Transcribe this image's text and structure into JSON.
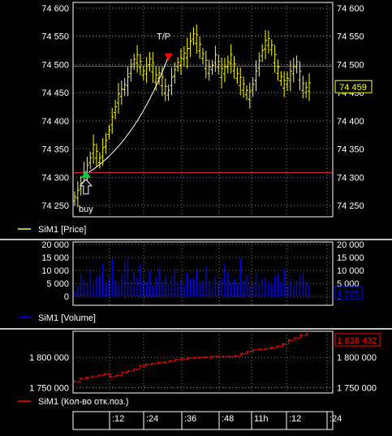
{
  "chart_data": [
    {
      "type": "line",
      "series": [
        {
          "name": "SiM1 [Price]",
          "style": "ohlc-bars",
          "color": "#ffff00",
          "values": [
            74262,
            74270,
            74285,
            74300,
            74315,
            74330,
            74350,
            74340,
            74330,
            74345,
            74360,
            74380,
            74400,
            74420,
            74440,
            74450,
            74460,
            74470,
            74490,
            74505,
            74510,
            74500,
            74485,
            74490,
            74505,
            74495,
            74475,
            74480,
            74470,
            74455,
            74450,
            74470,
            74485,
            74500,
            74505,
            74515,
            74520,
            74535,
            74550,
            74545,
            74530,
            74515,
            74500,
            74490,
            74495,
            74510,
            74500,
            74485,
            74490,
            74500,
            74510,
            74495,
            74480,
            74470,
            74460,
            74450,
            74445,
            74460,
            74480,
            74500,
            74520,
            74535,
            74540,
            74530,
            74510,
            74490,
            74475,
            74465,
            74470,
            74480,
            74490,
            74500,
            74480,
            74460,
            74455,
            74460
          ]
        }
      ],
      "ylim": [
        74230,
        74610
      ],
      "yticks": [
        "74 600",
        "74 550",
        "74 500",
        "74 450",
        "74 400",
        "74 350",
        "74 300",
        "74 250"
      ],
      "hlines": [
        {
          "value": 74497,
          "color": "#ff3030"
        },
        {
          "value": 74308,
          "color": "#ff3030"
        }
      ],
      "annotations": [
        {
          "text": "T/P",
          "x_index": 30,
          "y": 74514
        },
        {
          "text": "buy",
          "x_index": 1,
          "y": 74305
        }
      ],
      "last_value_label": "74 459",
      "legend": "SiM1 [Price]"
    },
    {
      "type": "bar",
      "series": [
        {
          "name": "SiM1 [Volume]",
          "color": "#0000ff",
          "values": [
            2000,
            4200,
            8600,
            6500,
            5200,
            10500,
            4200,
            7600,
            8100,
            12400,
            4800,
            6800,
            14200,
            6100,
            4400,
            8400,
            13200,
            15100,
            5600,
            9100,
            7400,
            12300,
            6400,
            5300,
            9800,
            4200,
            7200,
            11000,
            5600,
            8000,
            4600,
            7900,
            10800,
            5100,
            6300,
            4000,
            9200,
            6600,
            7100,
            9900,
            4900,
            6000,
            11700,
            6200,
            4300,
            7900,
            5000,
            7000,
            12600,
            9300,
            5100,
            6800,
            4800,
            14800,
            6200,
            8300,
            3900,
            5600,
            8900,
            4500,
            6900,
            7300,
            5600,
            4500,
            7600,
            8400,
            5700,
            10300,
            4100,
            6800,
            4300,
            5900,
            8100,
            9000,
            5800,
            4400
          ]
        }
      ],
      "ylim": [
        0,
        20000
      ],
      "yticks": [
        "20 000",
        "15 000",
        "10 000",
        "5 000",
        "0"
      ],
      "last_value_label": "1 926",
      "legend": "SiM1 [Volume]"
    },
    {
      "type": "line",
      "series": [
        {
          "name": "SiM1 (Кол-во отк.поз.)",
          "style": "steps",
          "color": "#ff0000",
          "values": [
            1760000,
            1765000,
            1766500,
            1768000,
            1770000,
            1772000,
            1768000,
            1770000,
            1775000,
            1777000,
            1780000,
            1786000,
            1788000,
            1789500,
            1791000,
            1792000,
            1794000,
            1796000,
            1797000,
            1798500,
            1799000,
            1800000,
            1800000,
            1801000,
            1801000,
            1801000,
            1801000,
            1802000,
            1806000,
            1809000,
            1812000,
            1813000,
            1814000,
            1816000,
            1818000,
            1822000,
            1828000,
            1832000,
            1836000,
            1838432
          ]
        }
      ],
      "ylim": [
        1741000,
        1843000
      ],
      "yticks": [
        "1 800 000",
        "1 750 000"
      ],
      "last_value_label": "1 838 432",
      "legend": "SiM1 (Кол-во отк.поз.)"
    }
  ],
  "x_axis": {
    "ticks": [
      ":12",
      ":24",
      ":36",
      ":48",
      "11h",
      ":12",
      ":24"
    ]
  },
  "colors": {
    "background": "#000000",
    "frame": "#ffffff",
    "grid": "#cfcfcf",
    "price": "#ffff00",
    "volume": "#0000ff",
    "positions": "#ff0000",
    "hline": "#ff3030",
    "annotation_curve": "#ffffff",
    "tp_marker": "#ff0000",
    "buy_marker": "#00cc44"
  }
}
